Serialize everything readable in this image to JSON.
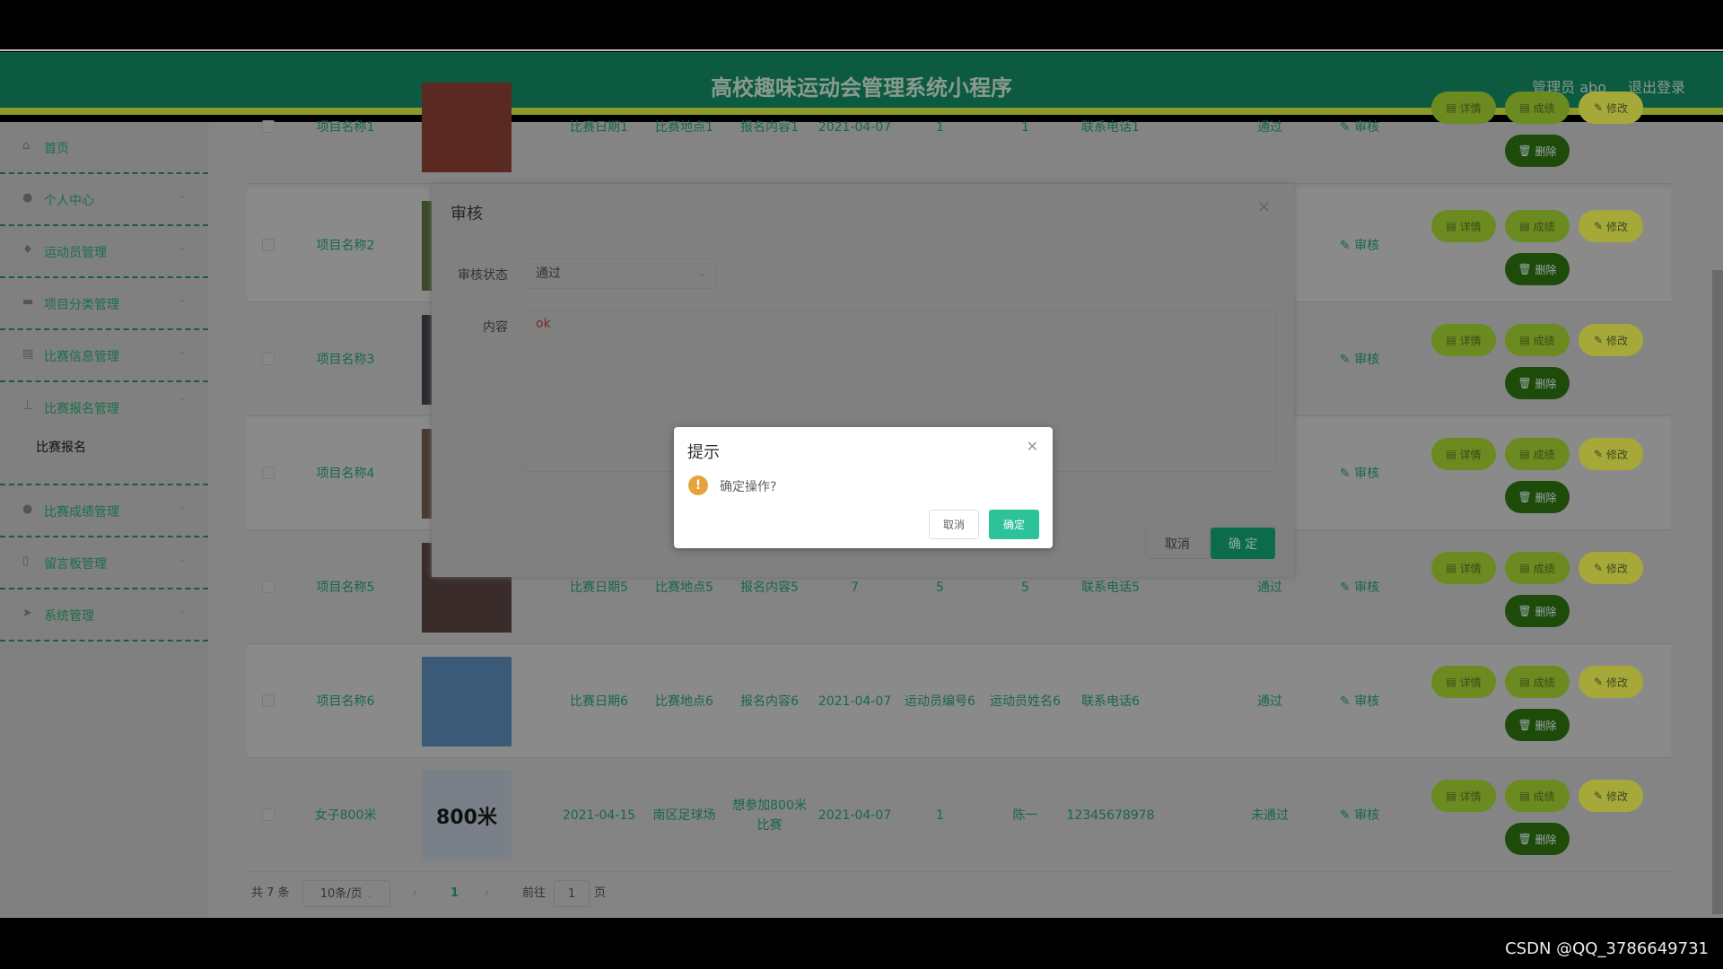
{
  "header": {
    "title": "高校趣味运动会管理系统小程序",
    "user": "管理员 abo",
    "logout": "退出登录"
  },
  "sidebar": {
    "items": [
      {
        "label": "首页",
        "icon": "home-icon",
        "expandable": false
      },
      {
        "label": "个人中心",
        "icon": "user-icon",
        "expandable": true
      },
      {
        "label": "运动员管理",
        "icon": "microphone-icon",
        "expandable": true
      },
      {
        "label": "项目分类管理",
        "icon": "briefcase-icon",
        "expandable": true
      },
      {
        "label": "比赛信息管理",
        "icon": "clipboard-icon",
        "expandable": true
      },
      {
        "label": "比赛报名管理",
        "icon": "stamp-icon",
        "expandable": true,
        "expanded": true
      },
      {
        "label": "比赛成绩管理",
        "icon": "user-icon",
        "expandable": true
      },
      {
        "label": "留言板管理",
        "icon": "phone-icon",
        "expandable": true
      },
      {
        "label": "系统管理",
        "icon": "send-icon",
        "expandable": true
      }
    ],
    "submenu": "比赛报名"
  },
  "table": {
    "rows": [
      {
        "name": "项目名称1",
        "date": "比赛日期1",
        "place": "比赛地点1",
        "content": "报名内容1",
        "signup_date": "2021-04-07",
        "athlete_no": "1",
        "athlete_name": "1",
        "phone": "联系电话1",
        "status": "通过",
        "image": "#5a2a22"
      },
      {
        "name": "项目名称2",
        "date": "",
        "place": "",
        "content": "",
        "signup_date": "",
        "athlete_no": "",
        "athlete_name": "",
        "phone": "",
        "status": "",
        "image": "#3a4a2a"
      },
      {
        "name": "项目名称3",
        "date": "",
        "place": "",
        "content": "",
        "signup_date": "",
        "athlete_no": "",
        "athlete_name": "",
        "phone": "",
        "status": "",
        "image": "#2a2a30"
      },
      {
        "name": "项目名称4",
        "date": "",
        "place": "",
        "content": "",
        "signup_date": "",
        "athlete_no": "",
        "athlete_name": "",
        "phone": "",
        "status": "",
        "image": "#4a3a32"
      },
      {
        "name": "项目名称5",
        "date": "比赛日期5",
        "place": "比赛地点5",
        "content": "报名内容5",
        "signup_date": "7",
        "athlete_no": "5",
        "athlete_name": "5",
        "phone": "联系电话5",
        "status": "通过",
        "image": "#3a2c2a"
      },
      {
        "name": "项目名称6",
        "date": "比赛日期6",
        "place": "比赛地点6",
        "content": "报名内容6",
        "signup_date": "2021-04-07",
        "athlete_no": "运动员编号6",
        "athlete_name": "运动员姓名6",
        "phone": "联系电话6",
        "status": "通过",
        "image": "#3a5a78"
      },
      {
        "name": "女子800米",
        "date": "2021-04-15",
        "place": "南区足球场",
        "content": "想参加800米比赛",
        "signup_date": "2021-04-07",
        "athlete_no": "1",
        "athlete_name": "陈一",
        "phone": "12345678978",
        "status": "未通过",
        "image": "#7a8088",
        "image_text": "800米"
      }
    ],
    "review_link": "审核",
    "actions": {
      "detail": "详情",
      "score": "成绩",
      "edit": "修改",
      "delete": "删除"
    }
  },
  "pagination": {
    "total": "共 7 条",
    "page_size": "10条/页",
    "current": "1",
    "goto_label": "前往",
    "goto_value": "1",
    "page_suffix": "页"
  },
  "review_dialog": {
    "title": "审核",
    "status_label": "审核状态",
    "status_value": "通过",
    "content_label": "内容",
    "content_value": "ok",
    "cancel": "取消",
    "confirm": "确 定"
  },
  "confirm_dialog": {
    "title": "提示",
    "message": "确定操作?",
    "cancel": "取消",
    "confirm": "确定",
    "icon": "warning-icon"
  },
  "watermark": "CSDN @QQ_3786649731",
  "colors": {
    "header": "#0c5a40",
    "accent": "#2ec29b",
    "warning": "#e6a23c"
  }
}
